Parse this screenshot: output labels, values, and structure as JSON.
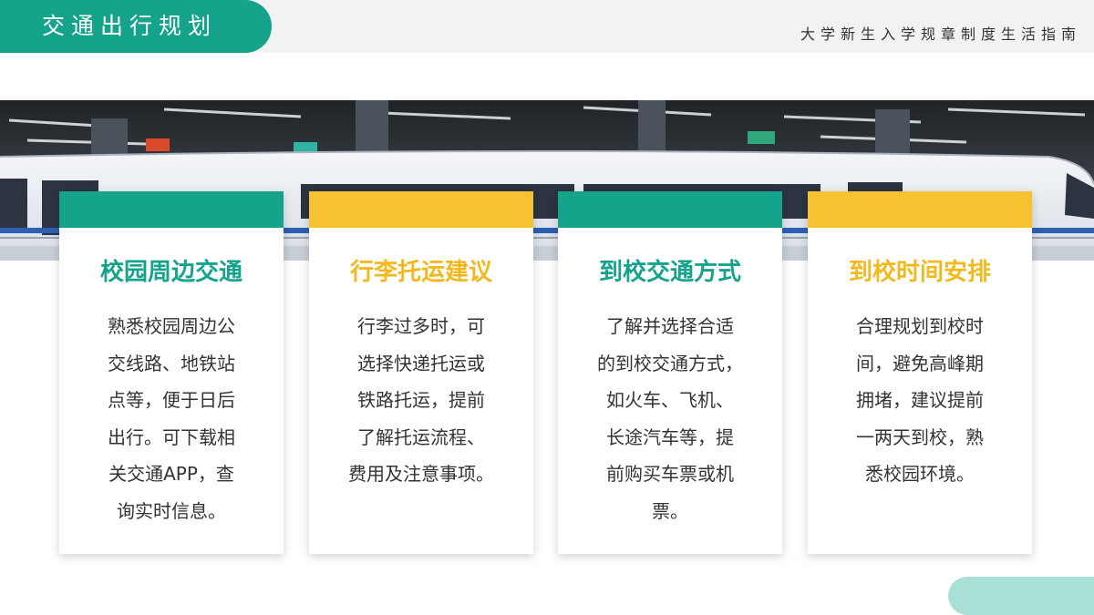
{
  "header": {
    "title": "交通出行规划",
    "subtitle": "大学新生入学规章制度生活指南"
  },
  "banner": {
    "image": "subway-train-station-photo"
  },
  "cards": [
    {
      "title": "校园周边交通",
      "body": "熟悉校园周边公\n交线路、地铁站\n点等，便于日后\n出行。可下载相\n关交通APP，查\n询实时信息。",
      "accent": "#16a38b"
    },
    {
      "title": "行李托运建议",
      "body": "行李过多时，可\n选择快递托运或\n铁路托运，提前\n了解托运流程、\n费用及注意事项。",
      "accent": "#f6c232"
    },
    {
      "title": "到校交通方式",
      "body": "了解并选择合适\n的到校交通方式，\n如火车、飞机、\n长途汽车等，提\n前购买车票或机\n票。",
      "accent": "#16a38b"
    },
    {
      "title": "到校时间安排",
      "body": "合理规划到校时\n间，避免高峰期\n拥堵，建议提前\n一两天到校，熟\n悉校园环境。",
      "accent": "#f6c232"
    }
  ],
  "colors": {
    "primary_teal": "#16a38b",
    "accent_yellow": "#f6c232",
    "light_teal": "#a9e0d6",
    "header_gray": "#f2f2f2"
  }
}
